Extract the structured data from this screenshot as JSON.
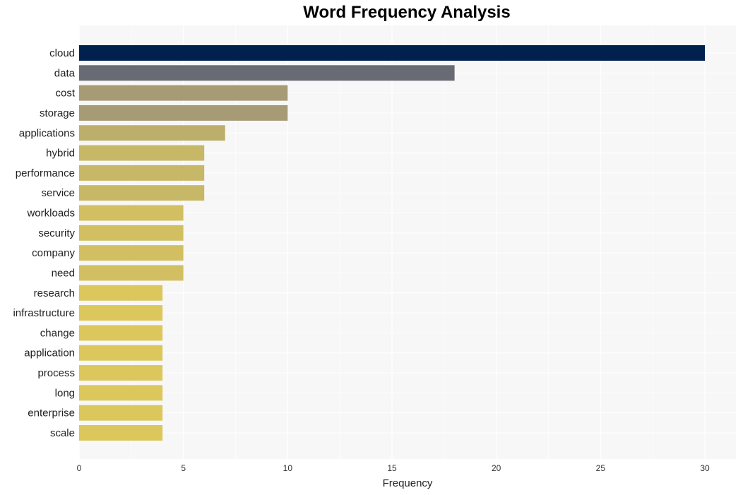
{
  "chart_data": {
    "type": "bar",
    "orientation": "horizontal",
    "title": "Word Frequency Analysis",
    "xlabel": "Frequency",
    "ylabel": "",
    "xlim": [
      0,
      31.5
    ],
    "xticks": [
      0,
      5,
      10,
      15,
      20,
      25,
      30
    ],
    "grid": true,
    "categories": [
      "cloud",
      "data",
      "cost",
      "storage",
      "applications",
      "hybrid",
      "performance",
      "service",
      "workloads",
      "security",
      "company",
      "need",
      "research",
      "infrastructure",
      "change",
      "application",
      "process",
      "long",
      "enterprise",
      "scale"
    ],
    "values": [
      30,
      18,
      10,
      10,
      7,
      6,
      6,
      6,
      5,
      5,
      5,
      5,
      4,
      4,
      4,
      4,
      4,
      4,
      4,
      4
    ],
    "colors": [
      "#00204e",
      "#686b73",
      "#a69b74",
      "#a69b74",
      "#bcaf6b",
      "#c7b867",
      "#c7b867",
      "#c7b867",
      "#d2bf62",
      "#d2bf62",
      "#d2bf62",
      "#d2bf62",
      "#dcc75c",
      "#dcc75c",
      "#dcc75c",
      "#dcc75c",
      "#dcc75c",
      "#dcc75c",
      "#dcc75c",
      "#dcc75c"
    ]
  }
}
